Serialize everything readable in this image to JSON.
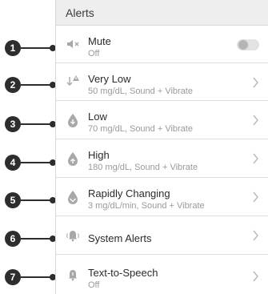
{
  "header": {
    "title": "Alerts"
  },
  "rows": [
    {
      "number": "1",
      "title": "Mute",
      "subtitle": "Off",
      "icon": "speaker-muted-icon",
      "control": "toggle",
      "toggle_on": false
    },
    {
      "number": "2",
      "title": "Very Low",
      "subtitle": "50 mg/dL, Sound + Vibrate",
      "icon": "very-low-alert-icon",
      "control": "chevron"
    },
    {
      "number": "3",
      "title": "Low",
      "subtitle": "70 mg/dL, Sound + Vibrate",
      "icon": "low-drop-icon",
      "control": "chevron"
    },
    {
      "number": "4",
      "title": "High",
      "subtitle": "180 mg/dL, Sound + Vibrate",
      "icon": "high-drop-icon",
      "control": "chevron"
    },
    {
      "number": "5",
      "title": "Rapidly Changing",
      "subtitle": "3 mg/dL/min, Sound + Vibrate",
      "icon": "rapid-change-drop-icon",
      "control": "chevron"
    },
    {
      "number": "6",
      "title": "System Alerts",
      "subtitle": "",
      "icon": "system-bell-icon",
      "control": "chevron"
    },
    {
      "number": "7",
      "title": "Text-to-Speech",
      "subtitle": "Off",
      "icon": "speech-bell-icon",
      "control": "chevron"
    }
  ],
  "colors": {
    "callout": "#2d2d2d",
    "icon": "#a8a8a8",
    "divider": "#dcdcdc",
    "header_bg": "#eeeeee"
  }
}
